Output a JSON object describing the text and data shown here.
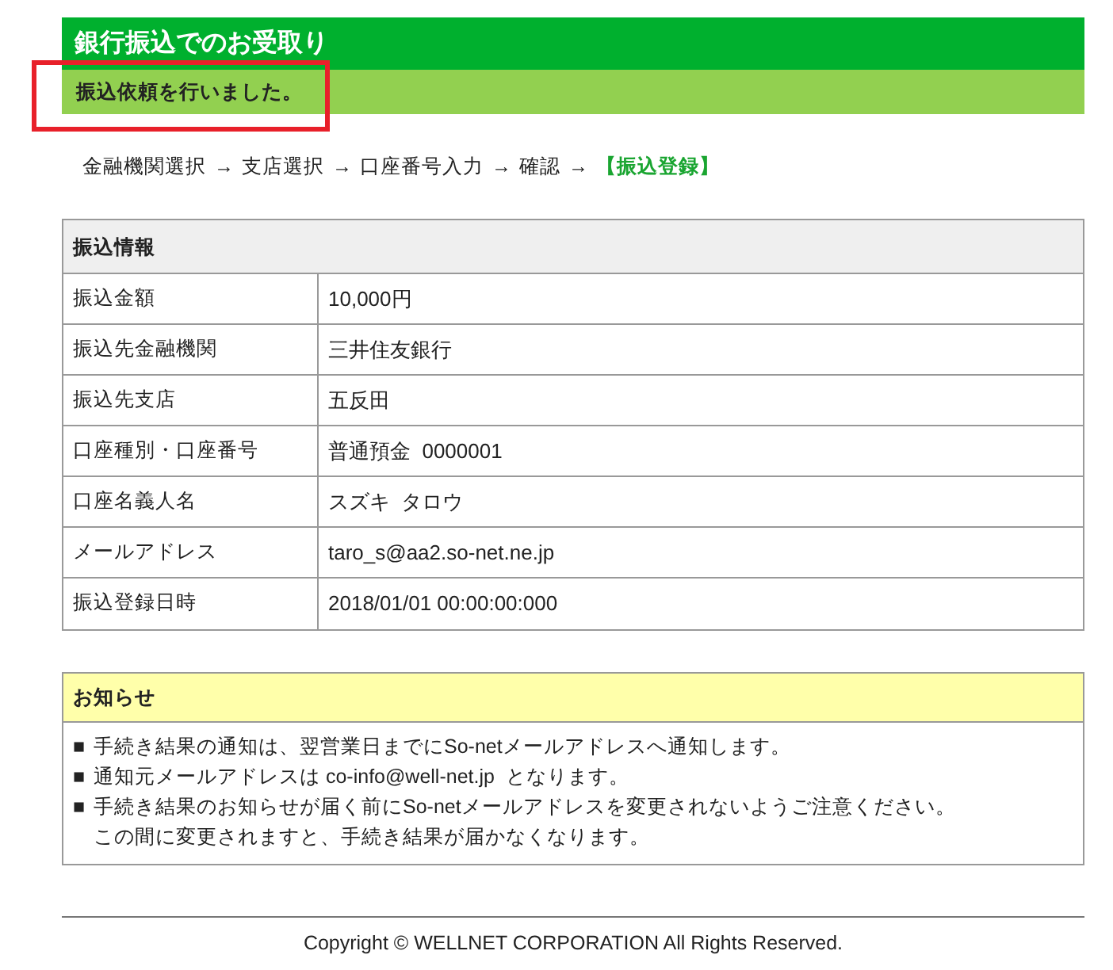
{
  "page_title": "銀行振込でのお受取り",
  "status_message": "振込依頼を行いました。",
  "breadcrumb": [
    {
      "kind": "step",
      "label": "金融機関選択",
      "selected": false
    },
    {
      "kind": "arrow",
      "label": "→"
    },
    {
      "kind": "step",
      "label": "支店選択",
      "selected": false
    },
    {
      "kind": "arrow",
      "label": "→"
    },
    {
      "kind": "step",
      "label": "口座番号入力",
      "selected": false
    },
    {
      "kind": "arrow",
      "label": "→"
    },
    {
      "kind": "step",
      "label": "確認",
      "selected": false
    },
    {
      "kind": "arrow",
      "label": "→"
    },
    {
      "kind": "step",
      "label": "【振込登録】",
      "selected": true
    }
  ],
  "transfer_info": {
    "title": "振込情報",
    "rows": [
      {
        "label": "振込金額",
        "value": "10,000円"
      },
      {
        "label": "振込先金融機関",
        "value": "三井住友銀行"
      },
      {
        "label": "振込先支店",
        "value": "五反田"
      },
      {
        "label": "口座種別・口座番号",
        "value": "普通預金  0000001"
      },
      {
        "label": "口座名義人名",
        "value": "スズキ  タロウ"
      },
      {
        "label": "メールアドレス",
        "value": "taro_s@aa2.so-net.ne.jp"
      },
      {
        "label": "振込登録日時",
        "value": "2018/01/01 00:00:00:000"
      }
    ]
  },
  "notice": {
    "title": "お知らせ",
    "lines": [
      {
        "bullet": "■",
        "text": "手続き結果の通知は、翌営業日までにSo-netメールアドレスへ通知します。"
      },
      {
        "bullet": "■",
        "text": "通知元メールアドレスは co-info@well-net.jp  となります。"
      },
      {
        "bullet": "■",
        "text": "手続き結果のお知らせが届く前にSo-netメールアドレスを変更されないようご注意ください。"
      },
      {
        "text": "この間に変更されますと、手続き結果が届かなくなります。"
      }
    ]
  },
  "footer": "Copyright © WELLNET CORPORATION All Rights Reserved."
}
